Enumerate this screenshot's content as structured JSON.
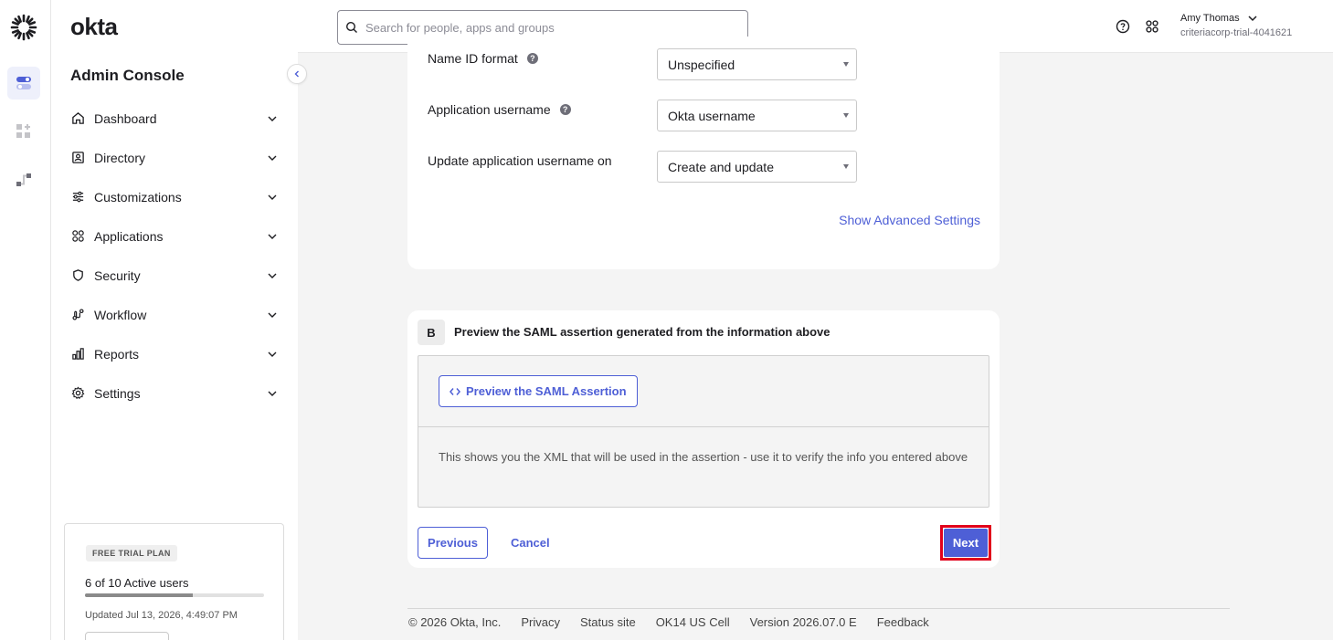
{
  "brand": {
    "name": "okta",
    "console_title": "Admin Console"
  },
  "sidebar": {
    "items": [
      {
        "label": "Dashboard",
        "icon": "home-icon"
      },
      {
        "label": "Directory",
        "icon": "directory-icon"
      },
      {
        "label": "Customizations",
        "icon": "sliders-icon"
      },
      {
        "label": "Applications",
        "icon": "apps-icon"
      },
      {
        "label": "Security",
        "icon": "shield-icon"
      },
      {
        "label": "Workflow",
        "icon": "workflow-icon"
      },
      {
        "label": "Reports",
        "icon": "reports-icon"
      },
      {
        "label": "Settings",
        "icon": "gear-icon"
      }
    ],
    "trial": {
      "badge": "FREE TRIAL PLAN",
      "users_text": "6 of 10 Active users",
      "active_users": 6,
      "max_users": 10,
      "updated": "Updated Jul 13, 2026, 4:49:07 PM"
    }
  },
  "header": {
    "search_placeholder": "Search for people, apps and groups",
    "user_name": "Amy Thomas",
    "user_org": "criteriacorp-trial-4041621"
  },
  "form": {
    "name_id_label": "Name ID format",
    "name_id_value": "Unspecified",
    "app_username_label": "Application username",
    "app_username_value": "Okta username",
    "update_on_label": "Update application username on",
    "update_on_value": "Create and update",
    "advanced_link": "Show Advanced Settings"
  },
  "step_b": {
    "badge": "B",
    "title": "Preview the SAML assertion generated from the information above",
    "preview_button": "Preview the SAML Assertion",
    "description": "This shows you the XML that will be used in the assertion - use it to verify the info you entered above"
  },
  "actions": {
    "previous": "Previous",
    "cancel": "Cancel",
    "next": "Next"
  },
  "footer": {
    "copyright": "© 2026 Okta, Inc.",
    "privacy": "Privacy",
    "status": "Status site",
    "cell": "OK14 US Cell",
    "version": "Version 2026.07.0 E",
    "feedback": "Feedback"
  },
  "colors": {
    "accent": "#4e5fd6",
    "highlight": "#e1001b"
  }
}
